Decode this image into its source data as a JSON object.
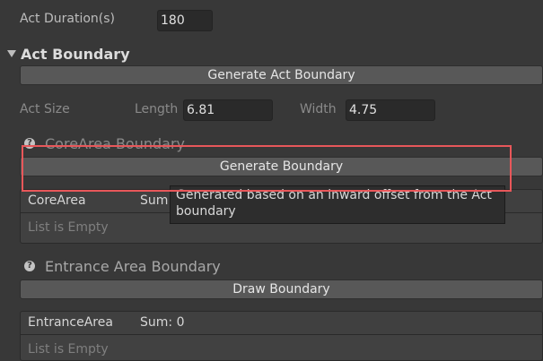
{
  "act_duration": {
    "label": "Act Duration(s)",
    "value": "180"
  },
  "act_boundary": {
    "title": "Act Boundary",
    "generate_button": "Generate Act Boundary",
    "size_label": "Act Size",
    "length_label": "Length",
    "length_value": "6.81",
    "width_label": "Width",
    "width_value": "4.75"
  },
  "core_area": {
    "title": "CoreArea Boundary",
    "generate_button": "Generate Boundary",
    "list_name": "CoreArea",
    "sum_label": "Sum",
    "empty_text": "List is Empty",
    "tooltip": "Generated based on an inward offset from the Act boundary"
  },
  "entrance_area": {
    "title": "Entrance Area Boundary",
    "draw_button": "Draw Boundary",
    "list_name": "EntranceArea",
    "sum_label": "Sum: 0",
    "empty_text": "List is Empty"
  }
}
